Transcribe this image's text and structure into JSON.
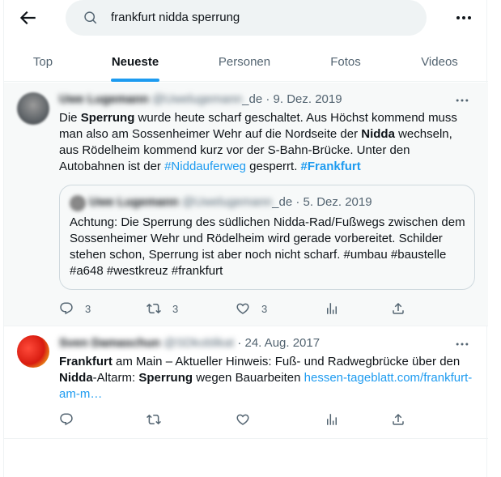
{
  "search": {
    "query": "frankfurt nidda sperrung"
  },
  "tabs": [
    "Top",
    "Neueste",
    "Personen",
    "Fotos",
    "Videos"
  ],
  "active_tab": "Neueste",
  "tweets": [
    {
      "author_name": "Uwe Lugemann",
      "handle_blurred": "@Uwelugemann",
      "handle_suffix": "_de",
      "date": "· 9. Dez. 2019",
      "text": {
        "p1": "Die ",
        "b1": "Sperrung",
        "p2": " wurde heute scharf geschaltet. Aus Höchst kommend muss man also am Sossenheimer Wehr auf die Nordseite der ",
        "b2": "Nidda",
        "p3": " wechseln, aus Rödelheim kommend kurz vor der S-Bahn-Brücke. Unter den Autobahnen ist der ",
        "link1": "#Niddauferweg",
        "p4": " gesperrt. ",
        "link2": "#Frankfurt"
      },
      "quote": {
        "author_name": "Uwe Lugemann",
        "handle_blurred": "@Uwelugemann",
        "handle_suffix": "_de",
        "date": "· 5. Dez. 2019",
        "text": "Achtung: Die Sperrung des südlichen Nidda-Rad/Fußwegs zwischen dem Sossenheimer Wehr und Rödelheim wird gerade vorbereitet. Schilder stehen schon, Sperrung ist aber noch nicht scharf. #umbau #baustelle #a648 #westkreuz #frankfurt"
      },
      "replies": "3",
      "retweets": "3",
      "likes": "3"
    },
    {
      "author_name": "Sven Damaschun",
      "handle_blurred": "@SDkoblikat",
      "date": "· 24. Aug. 2017",
      "text": {
        "b1": "Frankfurt",
        "p1": " am Main – Aktueller Hinweis: Fuß- und Radwegbrücke über den ",
        "b2": "Nidda",
        "p2": "-Altarm: ",
        "b3": "Sperrung",
        "p3": " wegen Bauarbeiten ",
        "link1": "hessen-tageblatt.com/frankfurt-am-m…"
      }
    }
  ],
  "colors": {
    "accent": "#1d9bf0",
    "muted": "#536471",
    "text": "#0f1419",
    "border": "#eff3f4",
    "highlight": "#f7f9f9"
  },
  "icons": [
    "back-arrow-icon",
    "search-icon",
    "more-icon",
    "reply-icon",
    "retweet-icon",
    "like-icon",
    "views-icon",
    "share-icon"
  ]
}
